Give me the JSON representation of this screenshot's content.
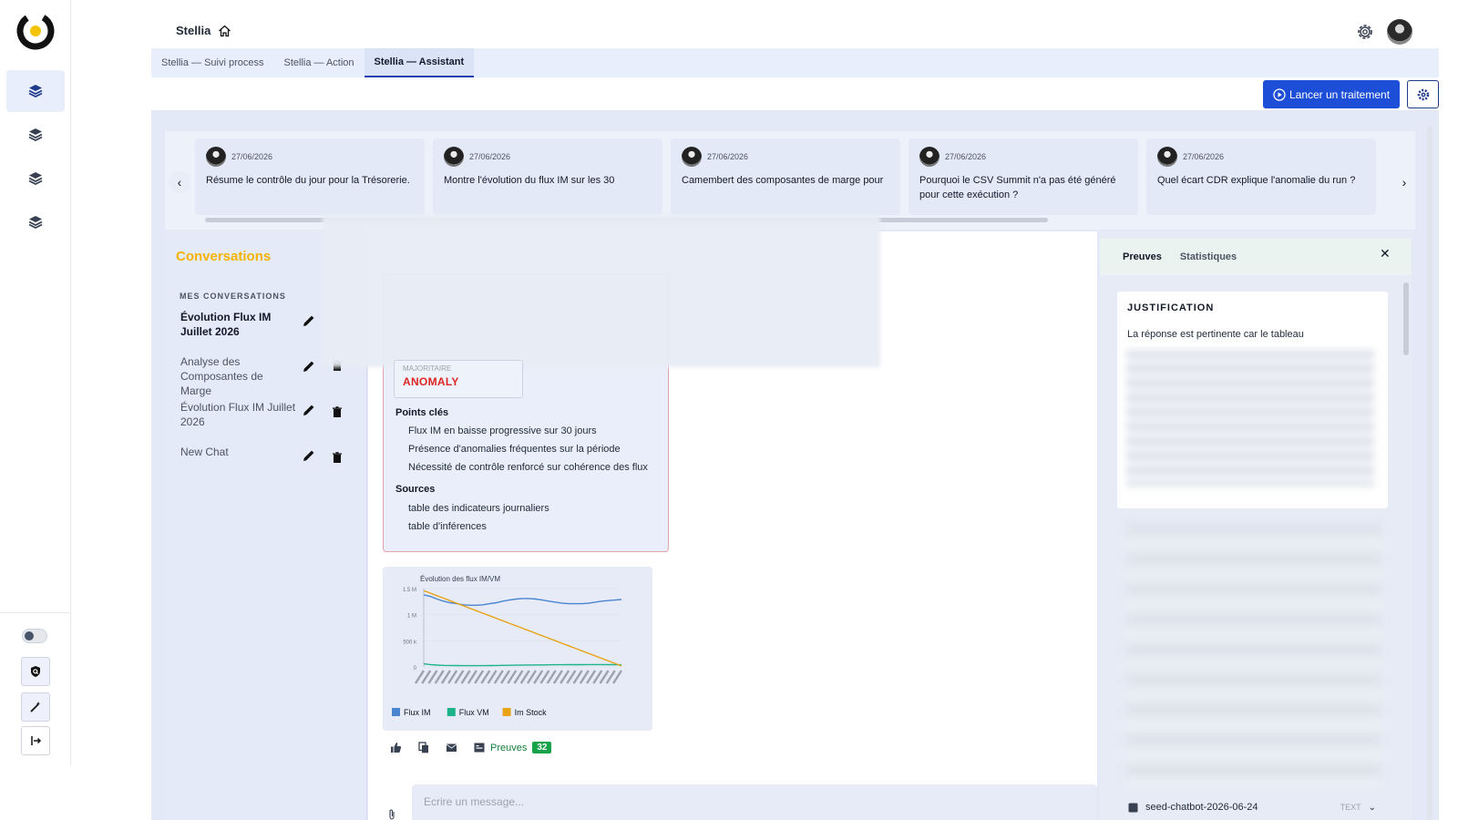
{
  "app": {
    "title": "Stellia",
    "tabs": [
      {
        "label": "Stellia — Suivi process",
        "active": false
      },
      {
        "label": "Stellia — Action",
        "active": false
      },
      {
        "label": "Stellia — Assistant",
        "active": true
      }
    ]
  },
  "toolbar": {
    "launch_label": "Lancer un traitement",
    "settings_icon": "gear-icon"
  },
  "prompts": [
    {
      "date": "27/06/2026",
      "text": "Résume le contrôle du jour pour la Trésorerie."
    },
    {
      "date": "27/06/2026",
      "text": "Montre l'évolution du flux IM sur les 30"
    },
    {
      "date": "27/06/2026",
      "text": "Camembert des composantes de marge pour"
    },
    {
      "date": "27/06/2026",
      "text": "Pourquoi le CSV Summit n'a pas été généré pour cette exécution ?"
    },
    {
      "date": "27/06/2026",
      "text": "Quel écart CDR explique l'anomalie du run ?"
    }
  ],
  "sidebar": {
    "title": "Conversations",
    "section_label": "MES CONVERSATIONS",
    "items": [
      {
        "label": "Évolution Flux IM Juillet 2026",
        "active": true
      },
      {
        "label": "Analyse des Composantes de Marge",
        "active": false
      },
      {
        "label": "Évolution Flux IM Juillet 2026",
        "active": false
      },
      {
        "label": "New Chat",
        "active": false
      }
    ]
  },
  "message": {
    "anomaly_sublabel": "MAJORITAIRE",
    "anomaly_value": "ANOMALY",
    "key_points_title": "Points clés",
    "key_points": [
      "Flux IM en baisse progressive sur 30 jours",
      "Présence d'anomalies fréquentes sur la période",
      "Nécessité de contrôle renforcé sur cohérence des flux"
    ],
    "sources_title": "Sources",
    "sources": [
      "table des indicateurs journaliers",
      "table d'inférences"
    ],
    "preuves_label": "Preuves",
    "preuves_count": "32"
  },
  "chart_data": {
    "type": "line",
    "title": "Évolution des flux IM/VM",
    "yticks": [
      "1.5 M",
      "1 M",
      "500 k",
      "0"
    ],
    "ylim": [
      0,
      1500000
    ],
    "x_count": 31,
    "series": [
      {
        "name": "Flux IM",
        "color": "#4a86cf",
        "values": [
          1380000,
          1350000,
          1300000,
          1260000,
          1230000,
          1210000,
          1190000,
          1180000,
          1180000,
          1190000,
          1210000,
          1230000,
          1260000,
          1280000,
          1300000,
          1310000,
          1310000,
          1300000,
          1280000,
          1260000,
          1240000,
          1220000,
          1210000,
          1210000,
          1210000,
          1220000,
          1240000,
          1260000,
          1270000,
          1280000,
          1290000
        ]
      },
      {
        "name": "Flux VM",
        "color": "#1fb38a",
        "values": [
          60000,
          45000,
          35000,
          30000,
          28000,
          26000,
          25000,
          24000,
          24000,
          25000,
          26000,
          28000,
          30000,
          32000,
          34000,
          36000,
          37000,
          38000,
          39000,
          40000,
          41000,
          42000,
          43000,
          44000,
          44000,
          45000,
          45000,
          45000,
          44000,
          43000,
          40000
        ]
      },
      {
        "name": "Im Stock",
        "color": "#e8a317",
        "values": [
          1460000,
          1412000,
          1364000,
          1316000,
          1268000,
          1220000,
          1172000,
          1124000,
          1076000,
          1028000,
          980000,
          932000,
          884000,
          836000,
          788000,
          740000,
          692000,
          644000,
          596000,
          548000,
          500000,
          452000,
          404000,
          356000,
          308000,
          260000,
          212000,
          164000,
          116000,
          68000,
          20000
        ]
      }
    ]
  },
  "composer": {
    "placeholder": "Ecrire un message..."
  },
  "right_panel": {
    "tabs": [
      {
        "label": "Preuves",
        "active": true
      },
      {
        "label": "Statistiques",
        "active": false
      }
    ],
    "justification_title": "JUSTIFICATION",
    "justification_text": "La réponse est pertinente car le tableau",
    "file_name": "seed-chatbot-2026-06-24",
    "file_tag": "TEXT"
  },
  "colors": {
    "accent": "#1d4ed8",
    "conversations_title": "#f5b301",
    "anomaly": "#dc2626",
    "preuves": "#16a34a"
  }
}
